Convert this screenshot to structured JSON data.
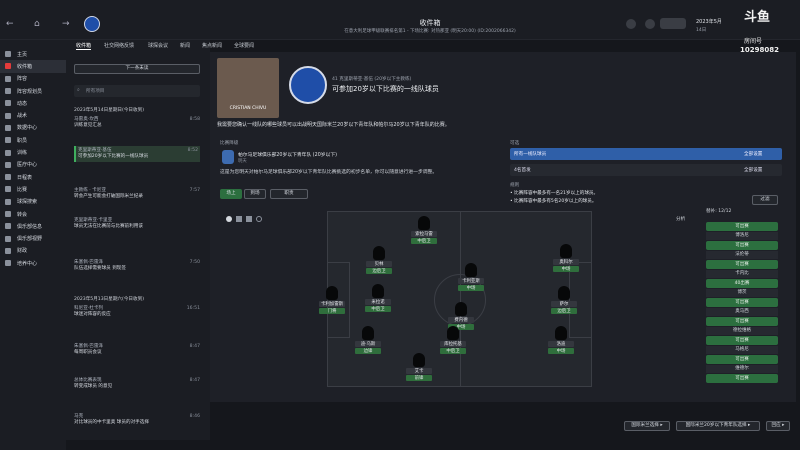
{
  "topbar": {
    "title": "收件箱",
    "subtitle": "在意大利足球甲级联赛排名第1 - 下场比赛: 对热那亚 (明天20:00) (ID:2002066342)",
    "date": "2023年5月",
    "date_sub": "14日",
    "streamer_logo": "斗鱼",
    "room_label": "房间号",
    "room_number": "10298082"
  },
  "sidebar": {
    "items": [
      {
        "label": "主页"
      },
      {
        "label": "收件箱"
      },
      {
        "label": "阵容"
      },
      {
        "label": "阵容规划员"
      },
      {
        "label": "动态"
      },
      {
        "label": "战术"
      },
      {
        "label": "数据中心"
      },
      {
        "label": "职员"
      },
      {
        "label": "训练"
      },
      {
        "label": "医疗中心"
      },
      {
        "label": "日程表"
      },
      {
        "label": "比赛"
      },
      {
        "label": "球探搜索"
      },
      {
        "label": "转会"
      },
      {
        "label": "俱乐部信息"
      },
      {
        "label": "俱乐部视野"
      },
      {
        "label": "财政"
      },
      {
        "label": "培养中心"
      }
    ]
  },
  "inbox": {
    "filter_button": "下一条未读",
    "search_placeholder": "所有项目",
    "messages": [
      {
        "date": "2023年5月14日星期日(今日收到)",
        "from": "马雷奥·坎西",
        "title": "训练意见汇总",
        "time": "8:58"
      },
      {
        "from": "克里斯蒂亚·基伍",
        "title": "可参加20岁以下比赛的一线队球员",
        "time": "8:52"
      },
      {
        "from": "主教练 · 卡尼亚",
        "title": "转会产生可能会打破国际米兰纪录",
        "time": "7:57"
      },
      {
        "from": "克里斯蒂亚·卡里亚",
        "title": "球员无法在比赛前与比赛前利用该",
        "time": ""
      },
      {
        "from": "朱塞佩·巴雷泽",
        "title": "队伍选择需要球员 到现签",
        "time": "7:50"
      },
      {
        "date": "2023年5月13日星期六(今日收到)",
        "from": "科尼亚·杜卡列",
        "title": "球迷对阵容的反应",
        "time": "16:51"
      },
      {
        "from": "朱塞佩·巴雷泽",
        "title": "每周职员会议",
        "time": "8:47"
      },
      {
        "from": "总体比赛表现",
        "title": "转变成球员 的意见",
        "time": "8:47"
      },
      {
        "from": "马克",
        "title": "对比球员的中卡里奥 球员的对手选择",
        "time": "8:46"
      }
    ]
  },
  "tabs": [
    "收件箱",
    "社交网络反馈",
    "球探会议",
    "新闻",
    "焦点新闻",
    "全球要闻"
  ],
  "message": {
    "sender_tag": "41 克里斯蒂亚·基伍 (20岁以下主教练)",
    "title": "可参加20岁以下比赛的一线队球员",
    "coach_name": "CRISTIAN CHIVU",
    "intro": "我需要您确认一线队的哪些球员可以出战明天国际米兰20岁以下青年队和帕尔马20岁以下青年队的比赛。",
    "upcoming_label": "比赛降级",
    "opponent_line": "帕尔马足球俱乐部20岁以下青年队 (20岁以下)",
    "opponent_sub": "明天",
    "details": "这是为您明天对帕尔马足球俱乐部20岁以下青年队比赛挑选的初步名单，你可以随意进行进一步调整。",
    "view_tabs": [
      "场上",
      "到场"
    ],
    "view_mode": "职责",
    "right_label": "可选",
    "dropdown1": "所有一线队球员",
    "dropdown1_right": "全部设置",
    "dropdown2": "4名首发",
    "dropdown2_right": "全部设置",
    "rules_title": "规则",
    "rule1": "• 比赛阵容中最多有一名21岁以上的球员。",
    "rule2": "• 比赛阵容中最多有5名20岁以上的球员。",
    "filter_btn": "过滤",
    "analysis_label": "分析",
    "count_label": "替补: 12/12"
  },
  "players": [
    {
      "name": "索拉马雷",
      "role": "中后卫"
    },
    {
      "name": "贝林",
      "role": "边后卫"
    },
    {
      "name": "卡利亚斯",
      "role": "中场"
    },
    {
      "name": "卡利加雷斯",
      "role": "门将"
    },
    {
      "name": "米拉诺",
      "role": "中后卫"
    },
    {
      "name": "奥科尔",
      "role": "中场"
    },
    {
      "name": "费内德",
      "role": "中场"
    },
    {
      "name": "迪·乌斯",
      "role": "边锋"
    },
    {
      "name": "艾卡",
      "role": "前锋"
    },
    {
      "name": "萨尔",
      "role": "边后卫"
    },
    {
      "name": "库拉托基",
      "role": "中后卫"
    },
    {
      "name": "洛迪",
      "role": "中场"
    }
  ],
  "bench": [
    {
      "status": "可出赛",
      "name": "博洛尼"
    },
    {
      "status": "可出赛",
      "name": "法伦蒂"
    },
    {
      "status": "可出赛",
      "name": "卡内比"
    },
    {
      "status": "40出赛",
      "name": "博茨"
    },
    {
      "status": "可出赛",
      "name": "奥马西"
    },
    {
      "status": "可出赛",
      "name": "德拉维格"
    },
    {
      "status": "可出赛",
      "name": "马格尼"
    },
    {
      "status": "可出赛",
      "name": "维德尔"
    },
    {
      "status": "可出赛",
      "name": ""
    }
  ],
  "footer": {
    "btn1": "国际米兰选择 ▸",
    "btn2": "国际米兰20岁以下青年队选择 ▸",
    "btn3": "回应 ▸"
  },
  "colors": {
    "accent": "#2c6f3f",
    "brand": "#1f4ea8",
    "alert": "#e43b3b"
  }
}
